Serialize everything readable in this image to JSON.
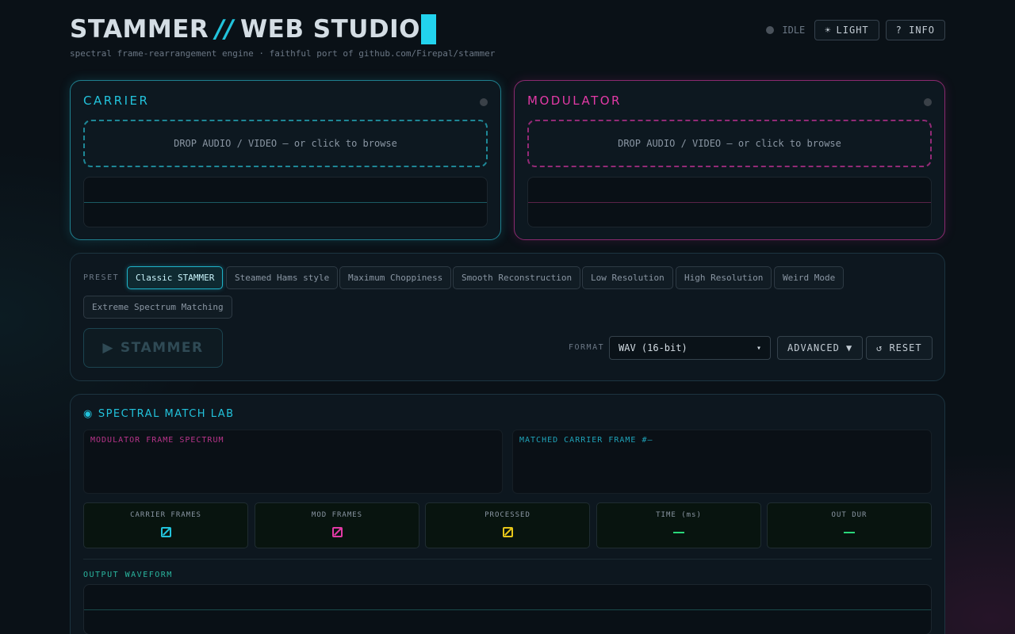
{
  "header": {
    "title_left": "STAMMER",
    "title_slash": "//",
    "title_right": "WEB STUDIO",
    "subtitle": "spectral frame-rearrangement engine · faithful port of github.com/Firepal/stammer",
    "status": "IDLE",
    "light_icon": "sun-icon",
    "light_label": "LIGHT",
    "info_label": "? INFO"
  },
  "carrier": {
    "title": "CARRIER",
    "drop_text": "DROP AUDIO / VIDEO — or click to browse",
    "accent": "#22c3dc"
  },
  "modulator": {
    "title": "MODULATOR",
    "drop_text": "DROP AUDIO / VIDEO — or click to browse",
    "accent": "#e23aa6"
  },
  "controls": {
    "preset_label": "PRESET",
    "presets": [
      "Classic STAMMER",
      "Steamed Hams style",
      "Maximum Choppiness",
      "Smooth Reconstruction",
      "Low Resolution",
      "High Resolution",
      "Weird Mode",
      "Extreme Spectrum Matching"
    ],
    "active_preset": "Classic STAMMER",
    "stammer_label": "STAMMER",
    "format_label": "FORMAT",
    "format_value": "WAV (16-bit)",
    "advanced_label": "ADVANCED ▼",
    "reset_label": "↺ RESET"
  },
  "lab": {
    "title": "SPECTRAL MATCH LAB",
    "mod_spectrum_label": "MODULATOR FRAME SPECTRUM",
    "matched_label": "MATCHED CARRIER FRAME #—",
    "stats": [
      {
        "label": "CARRIER FRAMES",
        "color": "#22c3dc"
      },
      {
        "label": "MOD FRAMES",
        "color": "#e23aa6"
      },
      {
        "label": "PROCESSED",
        "color": "#e6c619"
      },
      {
        "label": "TIME (ms)",
        "value": "—",
        "color": "#2ad67a"
      },
      {
        "label": "OUT DUR",
        "value": "—",
        "color": "#2ad67a"
      }
    ],
    "output_label": "OUTPUT WAVEFORM"
  }
}
